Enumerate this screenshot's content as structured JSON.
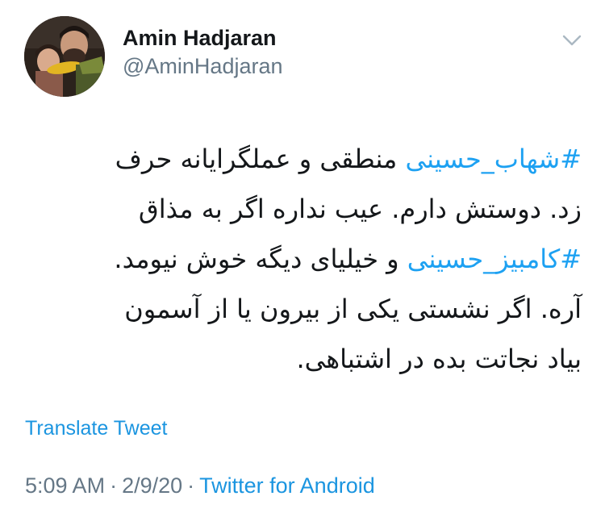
{
  "author": {
    "display_name": "Amin Hadjaran",
    "handle": "@AminHadjaran"
  },
  "icons": {
    "avatar": "profile-photo",
    "caret": "chevron-down-icon"
  },
  "colors": {
    "text": "#14171a",
    "secondary": "#657786",
    "link": "#1da1f2"
  },
  "tweet": {
    "line1": {
      "hashtag": "#شهاب_حسینی",
      "text": " منطقی و عملگرایانه حرف"
    },
    "line2": "زد. دوستش دارم. عیب نداره اگر به مذاق",
    "line3": {
      "hashtag": "#کامبیز_حسینی",
      "text": " و خیلیای دیگه خوش نیومد."
    },
    "line4": "آره. اگر نشستی یکی از بیرون یا از آسمون",
    "line5": "بیاد نجاتت بده در اشتباهی."
  },
  "translate_label": "Translate Tweet",
  "meta": {
    "time": "5:09 AM",
    "separator": "·",
    "date": "2/9/20",
    "source": "Twitter for Android"
  }
}
